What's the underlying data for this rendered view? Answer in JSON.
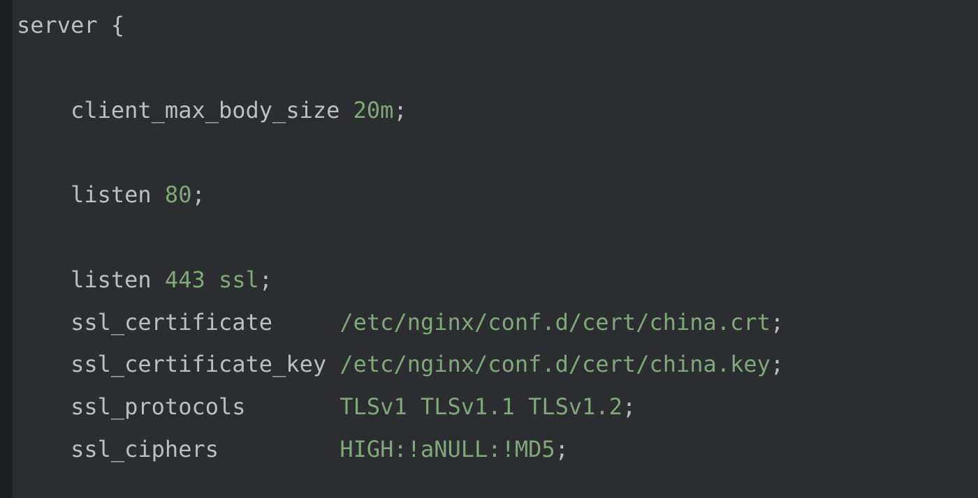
{
  "code": {
    "lines": [
      {
        "indent": "",
        "tokens": [
          {
            "text": "server",
            "class": "directive"
          },
          {
            "text": " ",
            "class": "directive"
          },
          {
            "text": "{",
            "class": "brace"
          }
        ]
      },
      {
        "indent": "",
        "tokens": []
      },
      {
        "indent": "    ",
        "tokens": [
          {
            "text": "client_max_body_size",
            "class": "directive"
          },
          {
            "text": " ",
            "class": "directive"
          },
          {
            "text": "20m",
            "class": "value"
          },
          {
            "text": ";",
            "class": "directive"
          }
        ]
      },
      {
        "indent": "",
        "tokens": []
      },
      {
        "indent": "    ",
        "tokens": [
          {
            "text": "listen",
            "class": "directive"
          },
          {
            "text": " ",
            "class": "directive"
          },
          {
            "text": "80",
            "class": "value"
          },
          {
            "text": ";",
            "class": "directive"
          }
        ]
      },
      {
        "indent": "",
        "tokens": []
      },
      {
        "indent": "    ",
        "tokens": [
          {
            "text": "listen",
            "class": "directive"
          },
          {
            "text": " ",
            "class": "directive"
          },
          {
            "text": "443",
            "class": "value"
          },
          {
            "text": " ",
            "class": "directive"
          },
          {
            "text": "ssl",
            "class": "value"
          },
          {
            "text": ";",
            "class": "directive"
          }
        ]
      },
      {
        "indent": "    ",
        "tokens": [
          {
            "text": "ssl_certificate",
            "class": "directive"
          },
          {
            "text": "     ",
            "class": "directive"
          },
          {
            "text": "/etc/nginx/conf.d/cert/china.crt",
            "class": "value"
          },
          {
            "text": ";",
            "class": "directive"
          }
        ]
      },
      {
        "indent": "    ",
        "tokens": [
          {
            "text": "ssl_certificate_key",
            "class": "directive"
          },
          {
            "text": " ",
            "class": "directive"
          },
          {
            "text": "/etc/nginx/conf.d/cert/china.key",
            "class": "value"
          },
          {
            "text": ";",
            "class": "directive"
          }
        ]
      },
      {
        "indent": "    ",
        "tokens": [
          {
            "text": "ssl_protocols",
            "class": "directive"
          },
          {
            "text": "       ",
            "class": "directive"
          },
          {
            "text": "TLSv1",
            "class": "value"
          },
          {
            "text": " ",
            "class": "directive"
          },
          {
            "text": "TLSv1.1",
            "class": "value"
          },
          {
            "text": " ",
            "class": "directive"
          },
          {
            "text": "TLSv1.2",
            "class": "value"
          },
          {
            "text": ";",
            "class": "directive"
          }
        ]
      },
      {
        "indent": "    ",
        "tokens": [
          {
            "text": "ssl_ciphers",
            "class": "directive"
          },
          {
            "text": "         ",
            "class": "directive"
          },
          {
            "text": "HIGH:!aNULL:!MD5",
            "class": "value"
          },
          {
            "text": ";",
            "class": "directive"
          }
        ]
      }
    ]
  }
}
